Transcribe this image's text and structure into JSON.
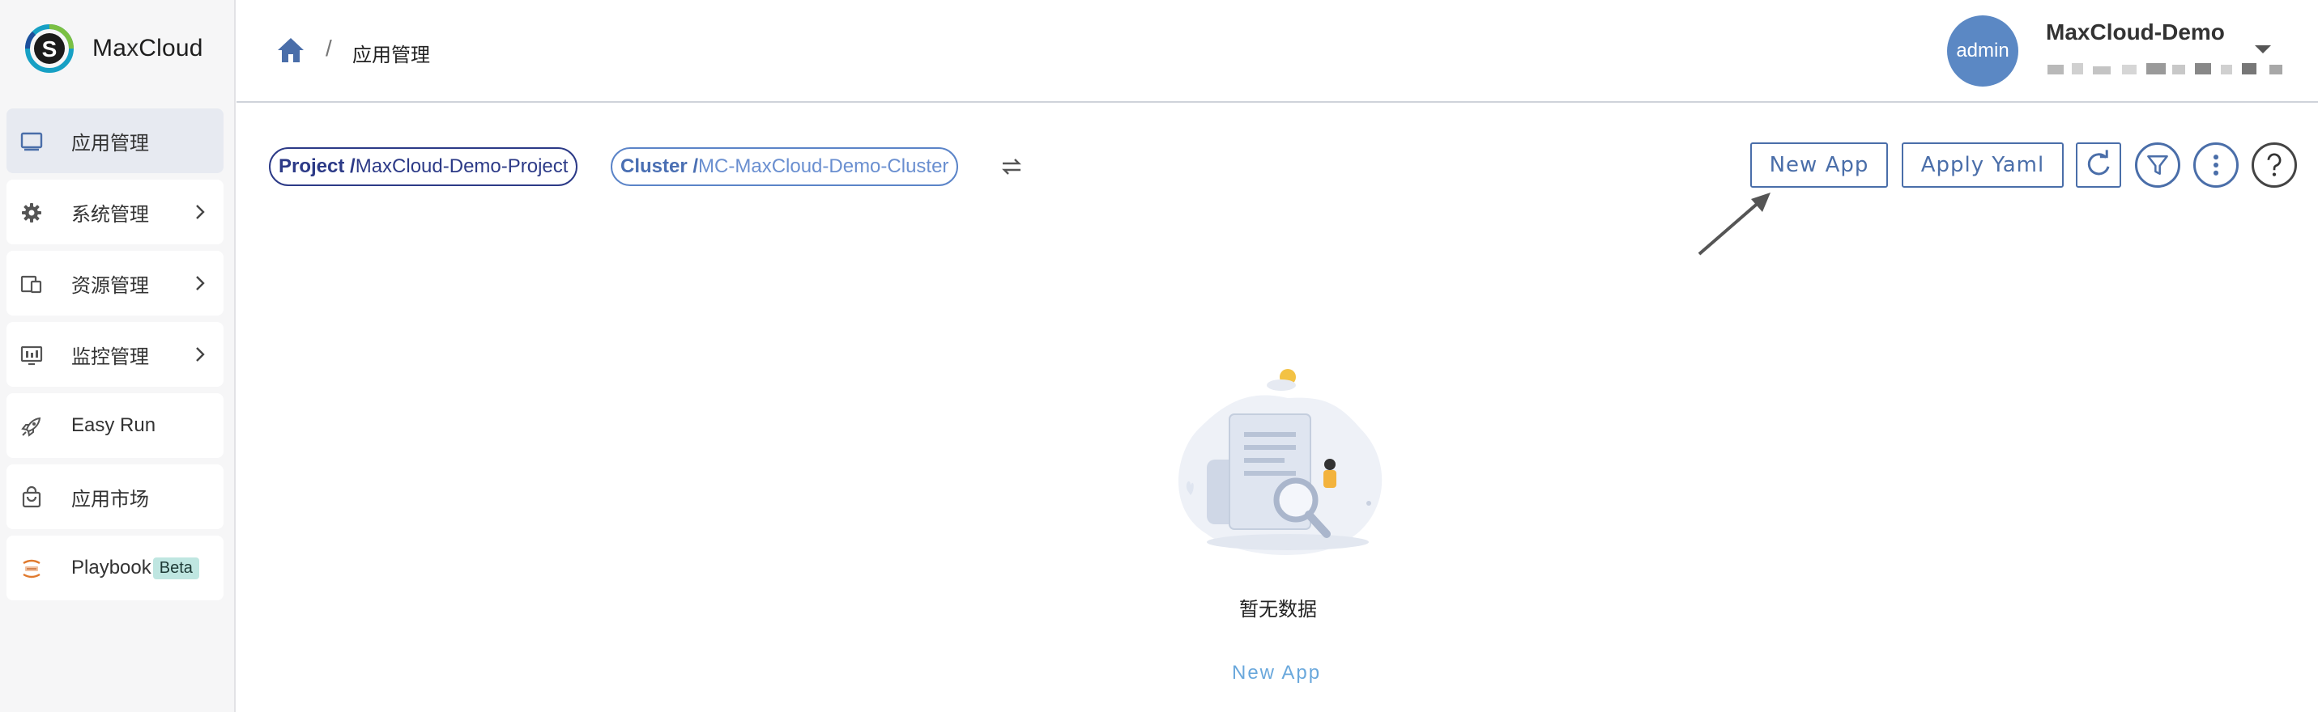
{
  "app": {
    "brand": "MaxCloud",
    "brand_prefix": "Ma",
    "brand_x": "x",
    "brand_suffix": "Cloud"
  },
  "colors": {
    "accent": "#4a6ea9",
    "sidebar_bg": "#f6f6f7",
    "active_item_bg": "#e7eaf1",
    "avatar_bg": "#5b88c4",
    "beta_bg": "#bfe6e1",
    "link": "#6aa8dc"
  },
  "sidebar": {
    "items": [
      {
        "label": "应用管理",
        "icon": "monitor-icon",
        "active": true,
        "has_submenu": false
      },
      {
        "label": "系统管理",
        "icon": "gear-icon",
        "active": false,
        "has_submenu": true
      },
      {
        "label": "资源管理",
        "icon": "devices-icon",
        "active": false,
        "has_submenu": true
      },
      {
        "label": "监控管理",
        "icon": "monitor-chart-icon",
        "active": false,
        "has_submenu": true
      },
      {
        "label": "Easy Run",
        "icon": "rocket-icon",
        "active": false,
        "has_submenu": false
      },
      {
        "label": "应用市场",
        "icon": "shopping-bag-icon",
        "active": false,
        "has_submenu": false
      },
      {
        "label": "Playbook",
        "icon": "playbook-icon",
        "active": false,
        "has_submenu": false,
        "badge": "Beta"
      }
    ]
  },
  "header": {
    "breadcrumb": {
      "home_icon": "home-icon",
      "separator": "/",
      "current": "应用管理"
    },
    "user": {
      "avatar_text": "admin",
      "name": "MaxCloud-Demo"
    }
  },
  "toolbar": {
    "project": {
      "prefix": "Project /",
      "value": "MaxCloud-Demo-Project"
    },
    "cluster": {
      "prefix": "Cluster /",
      "value": "MC-MaxCloud-Demo-Cluster"
    },
    "swap_icon": "swap-arrows-icon",
    "new_app_label": "New App",
    "apply_yaml_label": "Apply Yaml",
    "icon_buttons": [
      "refresh-icon",
      "filter-icon",
      "more-vertical-icon",
      "help-icon"
    ]
  },
  "empty_state": {
    "illustration": "empty-search-illustration",
    "message": "暂无数据",
    "action_label": "New App"
  }
}
